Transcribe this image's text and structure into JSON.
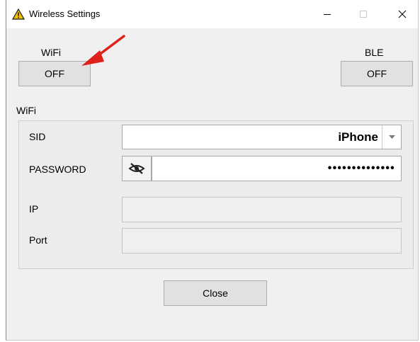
{
  "window": {
    "title": "Wireless Settings",
    "icon": "warning-triangle-icon",
    "controls": [
      "minimize-icon",
      "maximize-icon",
      "close-icon"
    ]
  },
  "wifi_toggle": {
    "label": "WiFi",
    "button": "OFF"
  },
  "ble_toggle": {
    "label": "BLE",
    "button": "OFF"
  },
  "wifi_group": {
    "title": "WiFi",
    "sid_label": "SID",
    "sid_value": "iPhone",
    "password_label": "PASSWORD",
    "password_value": "••••••••••••••",
    "ip_label": "IP",
    "ip_value": "",
    "port_label": "Port",
    "port_value": ""
  },
  "footer": {
    "close_label": "Close"
  },
  "colors": {
    "window_bg": "#f0f0f0",
    "button_bg": "#e1e1e1",
    "arrow": "#e0201b",
    "warning_icon": "#f2c200"
  }
}
